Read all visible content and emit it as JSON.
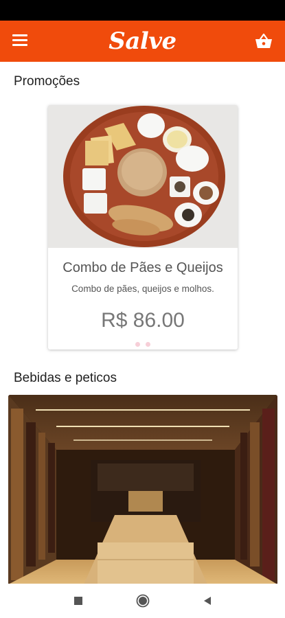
{
  "app": {
    "logo_text": "Salve",
    "brand_color": "#f04b0c"
  },
  "header": {
    "menu_icon": "hamburger-menu-icon",
    "cart_icon": "basket-icon"
  },
  "promotions": {
    "title": "Promoções",
    "items": [
      {
        "name": "Combo de Pães e Queijos",
        "description": "Combo de pães, queijos e molhos.",
        "price": "R$ 86.00"
      }
    ],
    "pager_dots": 2
  },
  "drinks": {
    "title": "Bebidas e peticos"
  },
  "system_nav": {
    "icons": [
      "square-icon",
      "home-circle-icon",
      "back-triangle-icon"
    ]
  }
}
